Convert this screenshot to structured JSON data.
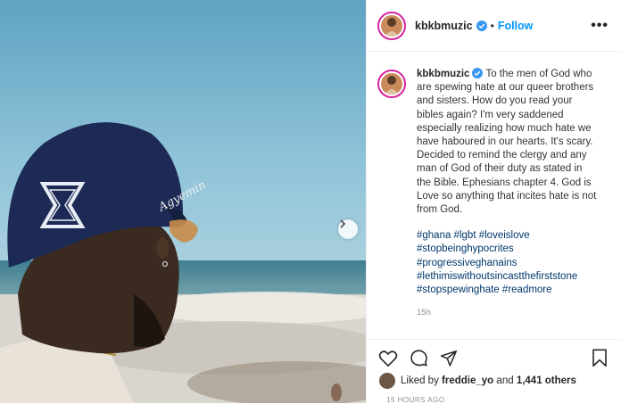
{
  "header": {
    "username": "kbkbmuzic",
    "separator": "•",
    "follow_label": "Follow",
    "more_label": "•••"
  },
  "caption": {
    "username": "kbkbmuzic",
    "text": "To the men of God who are spewing hate at our queer brothers and sisters. How do you read your bibles again? I'm very saddened especially realizing how much hate we have haboured in our hearts. It's scary. Decided to remind the clergy and any man of God of their duty as stated in the Bible. Ephesians chapter 4. God is Love so anything that incites hate is not from God.",
    "hashtags": [
      "#ghana",
      "#lgbt",
      "#loveislove",
      "#stopbeinghypocrites",
      "#progressiveghanains",
      "#lethimiswithoutsincastthefirststone",
      "#stopspewinghate",
      "#readmore"
    ],
    "time": "15h"
  },
  "image": {
    "cap_text": "Agyemin",
    "icons": [
      "next-arrow-icon"
    ]
  },
  "actions": {
    "icons": [
      "heart-icon",
      "comment-icon",
      "share-icon",
      "bookmark-icon"
    ]
  },
  "likes": {
    "prefix": "Liked by",
    "user": "freddie_yo",
    "middle": "and",
    "count": "1,441 others"
  },
  "posted_ago": "15 HOURS AGO",
  "colors": {
    "link": "#0095f6",
    "hashtag": "#00376b",
    "verified": "#3897f0",
    "story_ring": "#d6249f"
  }
}
